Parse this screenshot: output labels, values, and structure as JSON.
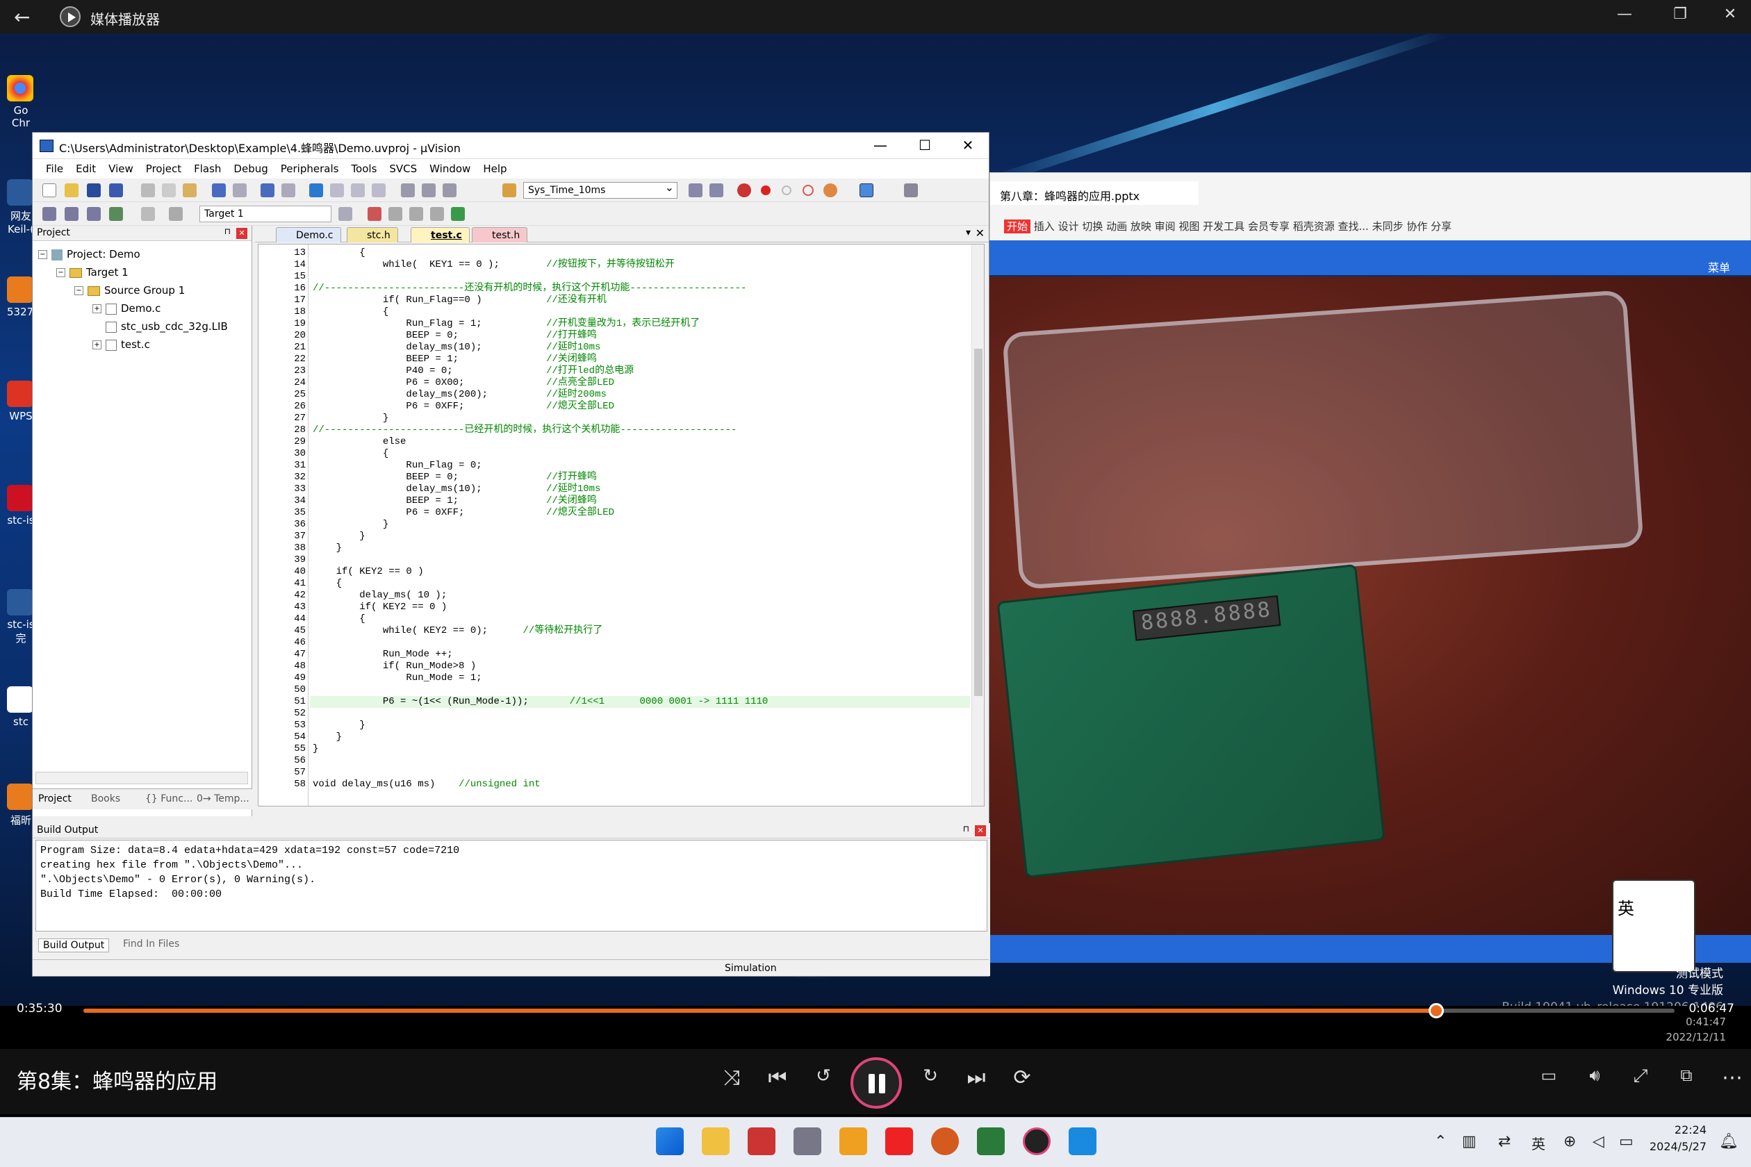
{
  "player": {
    "title": "媒体播放器",
    "episode": "第8集：蜂鸣器的应用",
    "elapsed": "0:35:30",
    "remaining": "0:06:47",
    "progress": 0.85,
    "accent": "#e86a1d"
  },
  "desktop_icons": [
    "Go Chr",
    "网友 Keil-(",
    "5327.",
    "WPS",
    "stc-is",
    "stc-is 完",
    "stc",
    "福昕"
  ],
  "uvision": {
    "title": "C:\\Users\\Administrator\\Desktop\\Example\\4.蜂鸣器\\Demo.uvproj - µVision",
    "menu": [
      "File",
      "Edit",
      "View",
      "Project",
      "Flash",
      "Debug",
      "Peripherals",
      "Tools",
      "SVCS",
      "Window",
      "Help"
    ],
    "function_select": "Sys_Time_10ms",
    "target_select": "Target 1",
    "project_pane": {
      "header": "Project",
      "root": "Project: Demo",
      "target": "Target 1",
      "group": "Source Group 1",
      "files": [
        "Demo.c",
        "stc_usb_cdc_32g.LIB",
        "test.c"
      ],
      "tabs": [
        "Project",
        "Books",
        "{} Func...",
        "0→ Temp..."
      ]
    },
    "editor_tabs": [
      "Demo.c",
      "stc.h",
      "test.c",
      "test.h"
    ],
    "code": [
      {
        "n": "13",
        "t": "        {"
      },
      {
        "n": "14",
        "t": "            while(  KEY1 == 0 );        ",
        "c": "//按钮按下，并等待按钮松开"
      },
      {
        "n": "15",
        "t": ""
      },
      {
        "n": "16",
        "t": "//------------------------还没有开机的时候，执行这个开机功能--------------------"
      },
      {
        "n": "17",
        "t": "            if( Run_Flag==0 )           ",
        "c": "//还没有开机"
      },
      {
        "n": "18",
        "t": "            {"
      },
      {
        "n": "19",
        "t": "                Run_Flag = 1;           ",
        "c": "//开机变量改为1，表示已经开机了"
      },
      {
        "n": "20",
        "t": "                BEEP = 0;               ",
        "c": "//打开蜂鸣"
      },
      {
        "n": "21",
        "t": "                delay_ms(10);           ",
        "c": "//延时10ms"
      },
      {
        "n": "22",
        "t": "                BEEP = 1;               ",
        "c": "//关闭蜂鸣"
      },
      {
        "n": "23",
        "t": "                P40 = 0;                ",
        "c": "//打开led的总电源"
      },
      {
        "n": "24",
        "t": "                P6 = 0X00;              ",
        "c": "//点亮全部LED"
      },
      {
        "n": "25",
        "t": "                delay_ms(200);          ",
        "c": "//延时200ms"
      },
      {
        "n": "26",
        "t": "                P6 = 0XFF;              ",
        "c": "//熄灭全部LED"
      },
      {
        "n": "27",
        "t": "            }"
      },
      {
        "n": "28",
        "t": "//------------------------已经开机的时候，执行这个关机功能--------------------"
      },
      {
        "n": "29",
        "t": "            else"
      },
      {
        "n": "30",
        "t": "            {"
      },
      {
        "n": "31",
        "t": "                Run_Flag = 0;"
      },
      {
        "n": "32",
        "t": "                BEEP = 0;               ",
        "c": "//打开蜂鸣"
      },
      {
        "n": "33",
        "t": "                delay_ms(10);           ",
        "c": "//延时10ms"
      },
      {
        "n": "34",
        "t": "                BEEP = 1;               ",
        "c": "//关闭蜂鸣"
      },
      {
        "n": "35",
        "t": "                P6 = 0XFF;              ",
        "c": "//熄灭全部LED"
      },
      {
        "n": "36",
        "t": "            }"
      },
      {
        "n": "37",
        "t": "        }"
      },
      {
        "n": "38",
        "t": "    }"
      },
      {
        "n": "39",
        "t": ""
      },
      {
        "n": "40",
        "t": "    if( KEY2 == 0 )"
      },
      {
        "n": "41",
        "t": "    {"
      },
      {
        "n": "42",
        "t": "        delay_ms( 10 );"
      },
      {
        "n": "43",
        "t": "        if( KEY2 == 0 )"
      },
      {
        "n": "44",
        "t": "        {"
      },
      {
        "n": "45",
        "t": "            while( KEY2 == 0);      ",
        "c": "//等待松开执行了"
      },
      {
        "n": "46",
        "t": ""
      },
      {
        "n": "47",
        "t": "            Run_Mode ++;"
      },
      {
        "n": "48",
        "t": "            if( Run_Mode>8 )"
      },
      {
        "n": "49",
        "t": "                Run_Mode = 1;"
      },
      {
        "n": "50",
        "t": ""
      },
      {
        "n": "51",
        "t": "            P6 = ~(1<< (Run_Mode-1));       ",
        "c": "//1<<1      0000 0001 -> 1111 1110"
      },
      {
        "n": "52",
        "t": ""
      },
      {
        "n": "53",
        "t": "        }"
      },
      {
        "n": "54",
        "t": "    }"
      },
      {
        "n": "55",
        "t": "}"
      },
      {
        "n": "56",
        "t": ""
      },
      {
        "n": "57",
        "t": ""
      },
      {
        "n": "58",
        "t": "void delay_ms(u16 ms)    ",
        "c": "//unsigned int"
      }
    ],
    "build_output": {
      "header": "Build Output",
      "lines": [
        "Program Size: data=8.4 edata+hdata=429 xdata=192 const=57 code=7210",
        "creating hex file from \".\\Objects\\Demo\"...",
        "\".\\Objects\\Demo\" - 0 Error(s), 0 Warning(s).",
        "Build Time Elapsed:  00:00:00"
      ],
      "tabs": [
        "Build Output",
        "Find In Files"
      ]
    },
    "status": "Simulation"
  },
  "ppt": {
    "tab": "第八章：蜂鸣器的应用.pptx",
    "menu_badge": "开始",
    "menu": "插入 设计 切换 动画 放映 审阅 视图 开发工具 会员专享 稻壳资源",
    "search": "查找...",
    "actions": "未同步  协作  分享"
  },
  "camera": {
    "menu": "菜单",
    "seg_display": "8888.8888"
  },
  "watermark": [
    "测试模式",
    "Windows 10 专业版",
    "Build 19041.vb_release.191206-1406"
  ],
  "inner_clock": [
    "0:41:47",
    "2022/12/11"
  ],
  "tray": {
    "time": "22:24",
    "date": "2024/5/27",
    "lang": "英"
  }
}
